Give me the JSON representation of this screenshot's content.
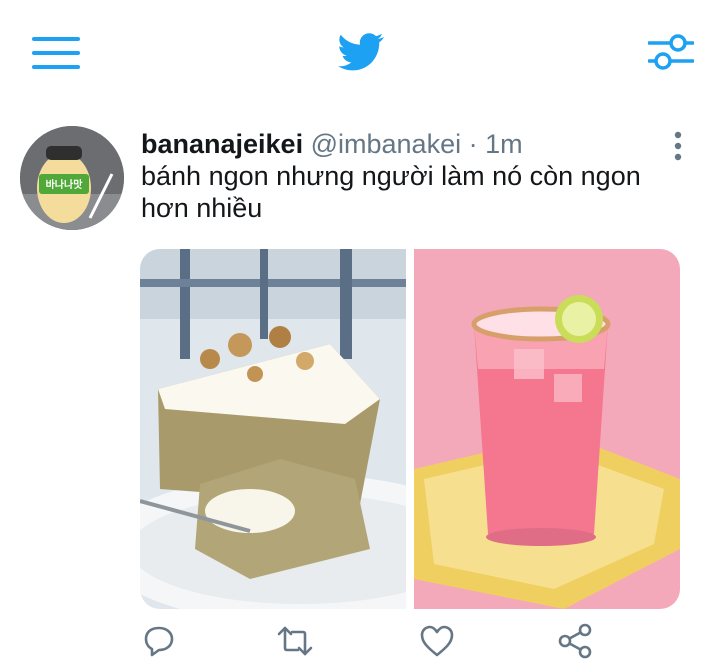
{
  "header": {
    "menu_icon": "hamburger-menu-icon",
    "logo_icon": "twitter-bird-icon",
    "filter_icon": "sliders-filter-icon"
  },
  "tweet": {
    "username": "bananajeikei",
    "handle": "@imbanakei",
    "separator": "·",
    "time": "1m",
    "text": "bánh ngon nhưng người làm nó còn ngon hơn nhiều",
    "more_icon": "vertical-ellipsis-icon",
    "avatar_label": "바나나맛",
    "media": [
      {
        "subject": "banana-cake-photo"
      },
      {
        "subject": "pink-lemonade-photo"
      }
    ],
    "actions": [
      "reply-icon",
      "retweet-icon",
      "like-icon",
      "share-icon"
    ]
  },
  "colors": {
    "accent": "#1da1f2",
    "text_primary": "#14171a",
    "text_secondary": "#657786"
  }
}
